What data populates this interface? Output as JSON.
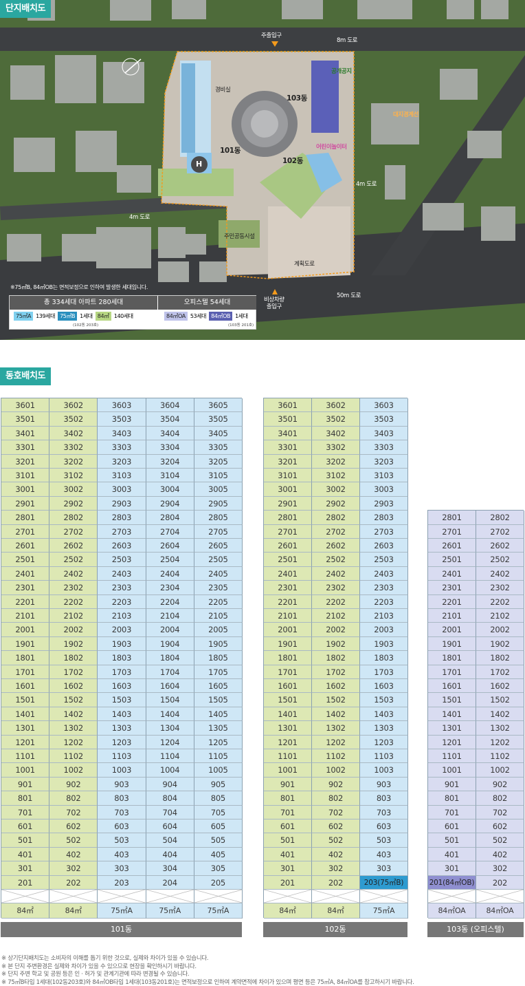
{
  "site_plan": {
    "header": "단지배치도",
    "labels": {
      "main_entrance": "주출입구",
      "road_8m": "8m 도로",
      "road_4m_left": "4m 도로",
      "road_4m_right": "4m 도로",
      "road_50m": "50m 도로",
      "public_space": "공개공지",
      "boundary": "대지경계선",
      "guard": "경비실",
      "daycare": "어린이놀이터",
      "community": "주민공동시설",
      "plan_road": "계획도로",
      "emergency": "비상차량\n출입구",
      "b101": "101동",
      "b102": "102동",
      "b103": "103동",
      "heliport": "H"
    },
    "footnote": "※75㎡B, 84㎡OB는 면적보정으로 인하여 발생한 세대입니다.",
    "summary": {
      "apt_head": "총 334세대 아파트 280세대",
      "off_head": "오피스텔 54세대",
      "apt_items": [
        {
          "chip": "75㎡A",
          "count": "139세대"
        },
        {
          "chip": "75㎡B",
          "count": "1세대"
        },
        {
          "chip": "84㎡",
          "count": "140세대"
        }
      ],
      "apt_sub": "(102동 203호)",
      "off_items": [
        {
          "chip": "84㎡OA",
          "count": "53세대"
        },
        {
          "chip": "84㎡OB",
          "count": "1세대"
        }
      ],
      "off_sub": "(103동 201호)"
    }
  },
  "unit_layout": {
    "header": "동호배치도",
    "buildings": [
      {
        "name": "101동",
        "types": [
          "84㎡",
          "84㎡",
          "75㎡A",
          "75㎡A",
          "75㎡A"
        ],
        "colors": [
          "g",
          "g",
          "b",
          "b",
          "b"
        ],
        "lines": [
          "01",
          "02",
          "03",
          "04",
          "05"
        ],
        "top_floor": 36
      },
      {
        "name": "102동",
        "types": [
          "84㎡",
          "84㎡",
          "75㎡A"
        ],
        "colors": [
          "g",
          "g",
          "b"
        ],
        "lines": [
          "01",
          "02",
          "03"
        ],
        "top_floor": 36,
        "special": {
          "floor": 2,
          "line": "03",
          "label": "203(75㎡B)"
        }
      },
      {
        "name": "103동 (오피스텔)",
        "types": [
          "84㎡OA",
          "84㎡OA"
        ],
        "colors": [
          "p",
          "p"
        ],
        "lines": [
          "01",
          "02"
        ],
        "top_floor": 28,
        "special": {
          "floor": 2,
          "line": "01",
          "label": "201(84㎡OB)"
        }
      }
    ],
    "notes": [
      "상기단지배치도는 소비자의 이해를 돕기 위한 것으로, 실제와 차이가 있을 수 있습니다.",
      "본 단지 주변환경은 실제와 차이가 있을 수 있으므로 현장을 확인하시기 바랍니다.",
      "단지 주변 학교 및 공원 등은 인 · 허가 및 관계기관에 따라 변경될 수 있습니다.",
      "75㎡B타입 1세대(102동203호)와 84㎡OB타입 1세대(103동201호)는 면적보정으로 인하여 계약면적에 차이가 있으며 평면 등은 75㎡A, 84㎡OA를 참고하시기 바랍니다."
    ]
  }
}
